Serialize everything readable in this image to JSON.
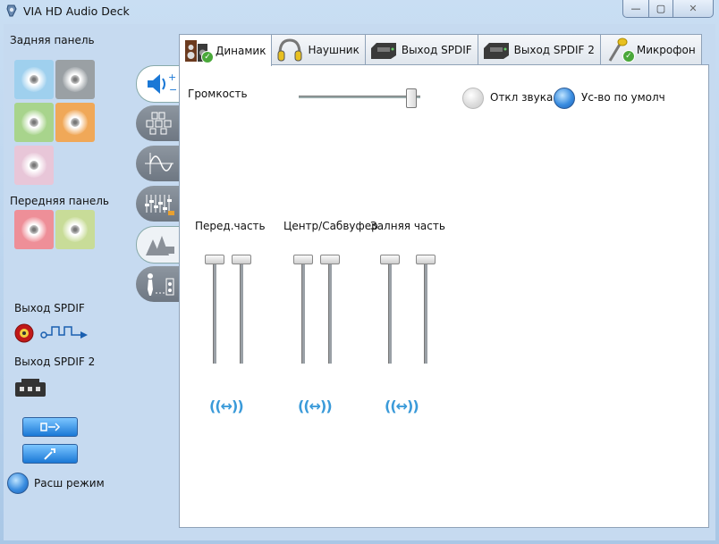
{
  "window": {
    "title": "VIA HD Audio Deck",
    "controls": {
      "minimize": "—",
      "maximize": "▢",
      "close": "✕"
    }
  },
  "sidebar": {
    "rear_panel_label": "Задняя панель",
    "front_panel_label": "Передняя панель",
    "spdif_label": "Выход SPDIF",
    "spdif2_label": "Выход SPDIF 2",
    "advanced_mode_label": "Расш режим",
    "rear_jacks": [
      {
        "name": "rear-jack-blue",
        "color": "#9fd0ee"
      },
      {
        "name": "rear-jack-gray",
        "color": "#9aa0a4"
      },
      {
        "name": "rear-jack-green",
        "color": "#a8d48c"
      },
      {
        "name": "rear-jack-orange",
        "color": "#f0a858"
      },
      {
        "name": "rear-jack-pink",
        "color": "#e8c6d8"
      }
    ],
    "front_jacks": [
      {
        "name": "front-jack-red",
        "color": "#ee8f98"
      },
      {
        "name": "front-jack-lime",
        "color": "#c8dc98"
      }
    ]
  },
  "vertical_tabs": [
    "speaker-volume-icon",
    "speaker-config-icon",
    "waveform-icon",
    "equalizer-icon",
    "environment-icon",
    "room-calibration-icon"
  ],
  "tabs": [
    {
      "label": "Динамик",
      "icon": "speaker-icon",
      "active": true,
      "checked": true
    },
    {
      "label": "Наушник",
      "icon": "headphones-icon",
      "active": false,
      "checked": false
    },
    {
      "label": "Выход SPDIF",
      "icon": "spdif-device-icon",
      "active": false,
      "checked": false
    },
    {
      "label": "Выход SPDIF 2",
      "icon": "spdif-device-icon",
      "active": false,
      "checked": false
    },
    {
      "label": "Микрофон",
      "icon": "microphone-icon",
      "active": false,
      "checked": true
    }
  ],
  "main": {
    "volume_label": "Громкость",
    "volume_level": 0.95,
    "mute_label": "Откл звука",
    "mute_on": false,
    "default_device_label": "Ус-во по умолч",
    "default_device_on": true,
    "channels": [
      {
        "label": "Перед.часть",
        "levels": [
          1.0,
          1.0
        ]
      },
      {
        "label": "Центр/Сабвуфер",
        "levels": [
          1.0,
          1.0
        ]
      },
      {
        "label": "Залняя часть",
        "levels": [
          1.0,
          1.0
        ]
      }
    ],
    "balance_glyph": "((↔))"
  },
  "colors": {
    "accent": "#3a8de0",
    "panel": "#c6daf0",
    "check": "#4aa83a"
  }
}
